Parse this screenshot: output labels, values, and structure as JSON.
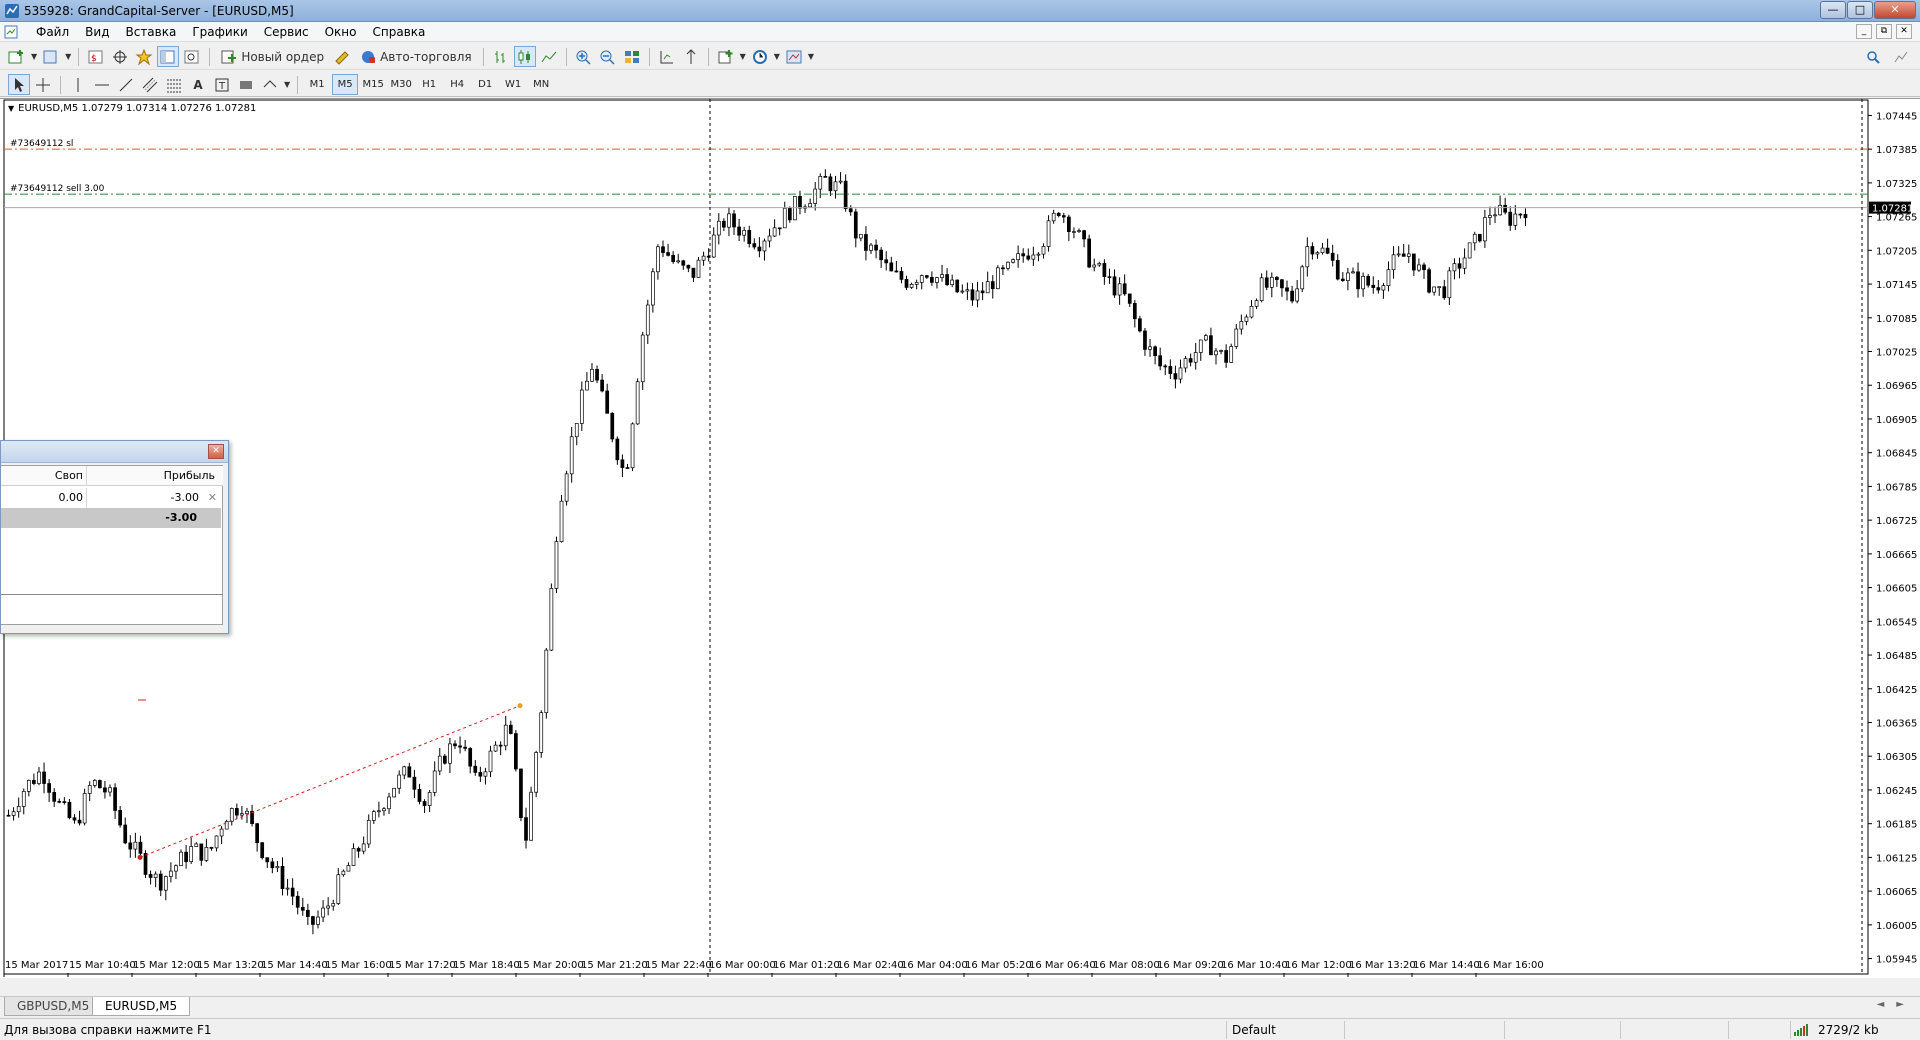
{
  "window": {
    "title": "535928: GrandCapital-Server - [EURUSD,M5]",
    "controls": [
      "—",
      "□",
      "✕"
    ]
  },
  "menu": {
    "items": [
      "Файл",
      "Вид",
      "Вставка",
      "Графики",
      "Сервис",
      "Окно",
      "Справка"
    ],
    "mdi_controls": [
      "_",
      "⧉",
      "✕"
    ]
  },
  "toolbar": {
    "new_order_label": "Новый ордер",
    "auto_trading_label": "Авто-торговля",
    "timeframes": [
      "M1",
      "M5",
      "M15",
      "M30",
      "H1",
      "H4",
      "D1",
      "W1",
      "MN"
    ],
    "active_timeframe": "M5"
  },
  "chart": {
    "header": "EURUSD,M5  1.07279 1.07314 1.07276 1.07281",
    "sl_label": "#73649112 sl",
    "order_label": "#73649112 sell 3.00",
    "current_price": "1.07281",
    "colors": {
      "sl_line": "#e05a2a",
      "order_line": "#2a8a2a",
      "bid_line": "#a8a8a8",
      "trend_line": "#d02020"
    }
  },
  "chart_data": {
    "type": "candlestick",
    "symbol": "EURUSD",
    "timeframe": "M5",
    "y_ticks": [
      "1.07445",
      "1.07385",
      "1.07325",
      "1.07265",
      "1.07205",
      "1.07145",
      "1.07085",
      "1.07025",
      "1.06965",
      "1.06905",
      "1.06845",
      "1.06785",
      "1.06725",
      "1.06665",
      "1.06605",
      "1.06545",
      "1.06485",
      "1.06425",
      "1.06365",
      "1.06305",
      "1.06245",
      "1.06185",
      "1.06125",
      "1.06065",
      "1.06005",
      "1.05945"
    ],
    "ylim": [
      1.0593,
      1.0746
    ],
    "x_ticks": [
      "15 Mar 2017",
      "15 Mar 10:40",
      "15 Mar 12:00",
      "15 Mar 13:20",
      "15 Mar 14:40",
      "15 Mar 16:00",
      "15 Mar 17:20",
      "15 Mar 18:40",
      "15 Mar 20:00",
      "15 Mar 21:20",
      "15 Mar 22:40",
      "16 Mar 00:00",
      "16 Mar 01:20",
      "16 Mar 02:40",
      "16 Mar 04:00",
      "16 Mar 05:20",
      "16 Mar 06:40",
      "16 Mar 08:00",
      "16 Mar 09:20",
      "16 Mar 10:40",
      "16 Mar 12:00",
      "16 Mar 13:20",
      "16 Mar 14:40",
      "16 Mar 16:00"
    ],
    "levels": {
      "stop_loss": 1.07385,
      "order_price": 1.07305,
      "bid": 1.07281
    },
    "close_path": [
      1.062,
      1.0625,
      1.0628,
      1.0622,
      1.0618,
      1.0626,
      1.0624,
      1.0616,
      1.0612,
      1.0608,
      1.0611,
      1.0614,
      1.0613,
      1.062,
      1.0622,
      1.0615,
      1.061,
      1.0606,
      1.06,
      1.0603,
      1.0609,
      1.0614,
      1.062,
      1.0625,
      1.0628,
      1.0622,
      1.063,
      1.0634,
      1.0626,
      1.0631,
      1.0636,
      1.0615,
      1.064,
      1.0675,
      1.069,
      1.07,
      1.069,
      1.068,
      1.0705,
      1.0722,
      1.0718,
      1.0716,
      1.0721,
      1.0726,
      1.0724,
      1.0722,
      1.0725,
      1.0728,
      1.073,
      1.0733,
      1.0731,
      1.0722,
      1.072,
      1.0716,
      1.0715,
      1.0717,
      1.0715,
      1.0713,
      1.0712,
      1.0715,
      1.0717,
      1.072,
      1.0722,
      1.0728,
      1.0724,
      1.0718,
      1.0715,
      1.0712,
      1.0705,
      1.07,
      1.0699,
      1.0702,
      1.0704,
      1.0701,
      1.0708,
      1.0714,
      1.0714,
      1.0712,
      1.0722,
      1.072,
      1.0716,
      1.0715,
      1.0714,
      1.0718,
      1.072,
      1.0715,
      1.0713,
      1.0718,
      1.0722,
      1.0728,
      1.0726,
      1.0728
    ]
  },
  "trade_panel": {
    "columns": [
      "Своп",
      "Прибыль"
    ],
    "rows": [
      {
        "swap": "0.00",
        "profit": "-3.00"
      }
    ],
    "total": "-3.00"
  },
  "tabs": [
    {
      "label": "GBPUSD,M5"
    },
    {
      "label": "EURUSD,M5"
    }
  ],
  "status": {
    "help": "Для вызова справки нажмите F1",
    "profile": "Default",
    "traffic": "2729/2 kb"
  }
}
